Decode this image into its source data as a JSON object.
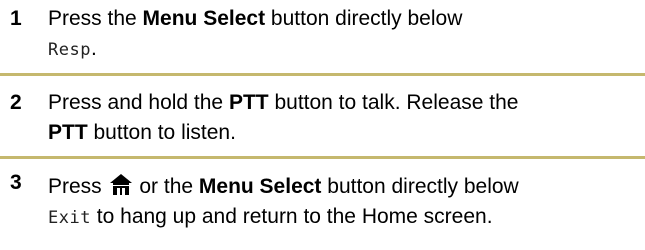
{
  "colors": {
    "divider": "#C5B86E",
    "text": "#000000"
  },
  "steps": [
    {
      "number": "1",
      "parts": {
        "t1": "Press the ",
        "b1": "Menu Select",
        "t2": " button directly below",
        "m1": "Resp",
        "t3": "."
      }
    },
    {
      "number": "2",
      "parts": {
        "t1": "Press and hold the ",
        "b1": "PTT",
        "t2": " button to talk. Release the",
        "b2": "PTT",
        "t3": " button to listen."
      }
    },
    {
      "number": "3",
      "icon": "home-icon",
      "parts": {
        "t1": "Press ",
        "t2": " or the ",
        "b1": "Menu Select",
        "t3": " button directly below",
        "m1": "Exit",
        "t4": " to hang up and return to the Home screen."
      }
    }
  ]
}
